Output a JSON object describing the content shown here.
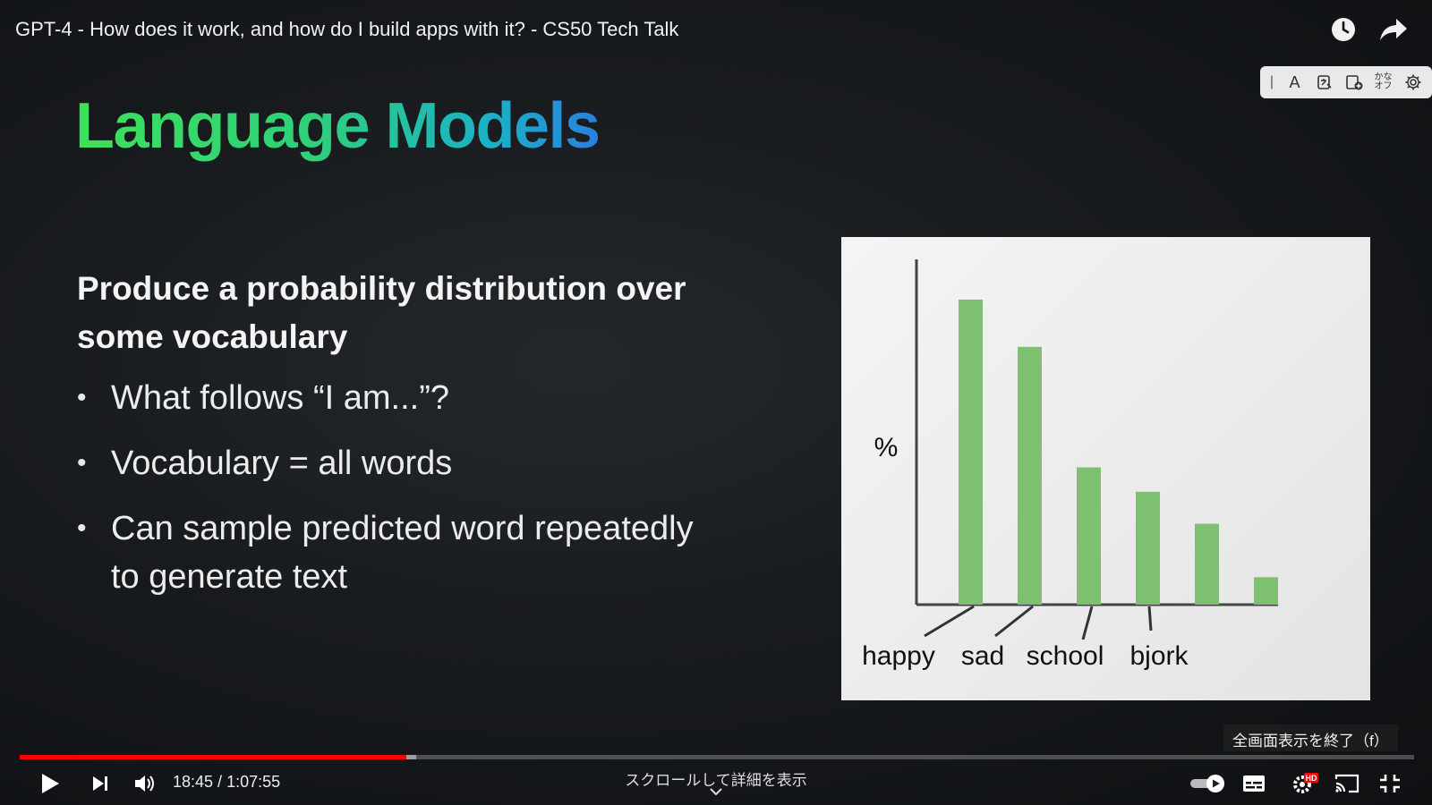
{
  "video": {
    "title": "GPT-4 - How does it work, and how do I build apps with it? - CS50 Tech Talk"
  },
  "top_icons": [
    "clock-icon",
    "share-arrow-icon"
  ],
  "extension_toolbar": {
    "grip": "|",
    "font_button": "A",
    "kana_line1": "かな",
    "kana_line2": "オフ"
  },
  "slide": {
    "title": "Language Models",
    "heading": "Produce a probability distribution over some vocabulary",
    "bullets": [
      "What follows “I am...”?",
      "Vocabulary = all words",
      "Can sample predicted word repeatedly to generate text"
    ]
  },
  "chart_data": {
    "type": "bar",
    "ylabel": "%",
    "xlabel": "",
    "categories": [
      "happy",
      "sad",
      "school",
      "bjork",
      "",
      ""
    ],
    "values": [
      100,
      84.5,
      45,
      37,
      26.5,
      9
    ],
    "ylim": [
      0,
      112
    ],
    "grid": false,
    "bar_color": "#7dc06f",
    "axis_color": "#444444"
  },
  "overlay": {
    "exit_fullscreen": "全画面表示を終了（f）"
  },
  "player": {
    "progress": 0.2772,
    "buffered": 0.2842,
    "current_time": "18:45",
    "duration": "1:07:55",
    "time_separator": " / ",
    "scroll_hint": "スクロールして詳細を表示",
    "hd_badge": "HD",
    "accent_color": "#ff0000"
  }
}
